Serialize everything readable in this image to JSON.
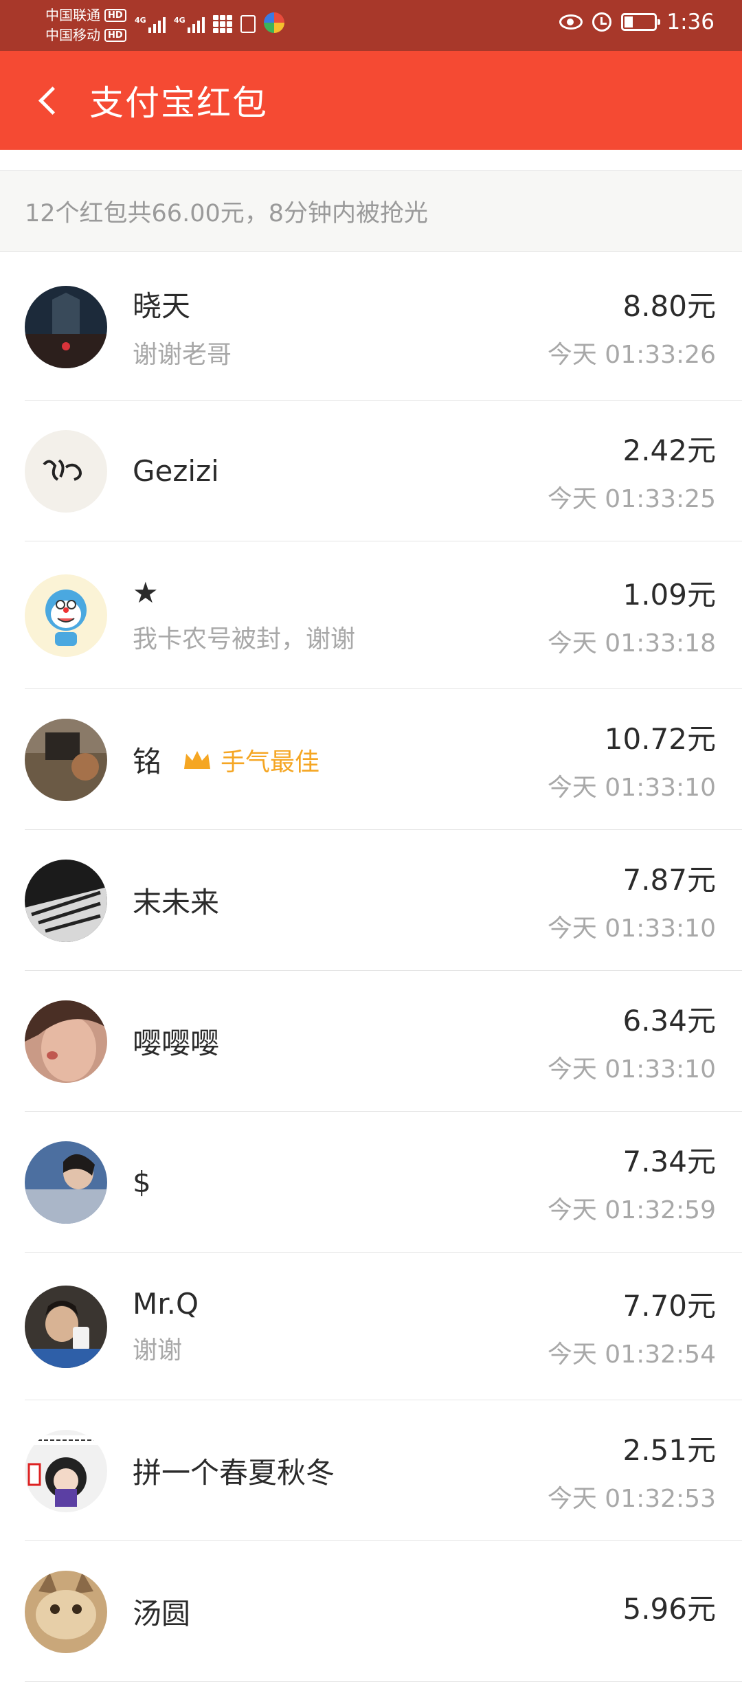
{
  "status_bar": {
    "carrier1": "中国联通",
    "carrier2": "中国移动",
    "hd": "HD",
    "net1": "4G",
    "net2": "4G",
    "time": "1:36"
  },
  "header": {
    "title": "支付宝红包"
  },
  "summary": {
    "text": "12个红包共66.00元，8分钟内被抢光"
  },
  "records": [
    {
      "name": "晓天",
      "note": "谢谢老哥",
      "amount": "8.80元",
      "time": "今天 01:33:26"
    },
    {
      "name": "Gezizi",
      "note": "",
      "amount": "2.42元",
      "time": "今天 01:33:25"
    },
    {
      "name": "★",
      "note": "我卡农号被封，谢谢",
      "amount": "1.09元",
      "time": "今天 01:33:18"
    },
    {
      "name": "铭",
      "note": "",
      "badge": "手气最佳",
      "amount": "10.72元",
      "time": "今天 01:33:10"
    },
    {
      "name": "末未来",
      "note": "",
      "amount": "7.87元",
      "time": "今天 01:33:10"
    },
    {
      "name": "嘤嘤嘤",
      "note": "",
      "amount": "6.34元",
      "time": "今天 01:33:10"
    },
    {
      "name": "$",
      "note": "",
      "amount": "7.34元",
      "time": "今天 01:32:59"
    },
    {
      "name": "Mr.Q",
      "note": "谢谢",
      "amount": "7.70元",
      "time": "今天 01:32:54"
    },
    {
      "name": "拼一个春夏秋冬",
      "note": "",
      "amount": "2.51元",
      "time": "今天 01:32:53"
    },
    {
      "name": "汤圆",
      "note": "",
      "amount": "5.96元",
      "time": ""
    }
  ],
  "avatar_colors": [
    "#1c2a3a",
    "#f3f0ea",
    "#fbf3d6",
    "#6b5a45",
    "#1b1b1b",
    "#c99a86",
    "#4c6fa0",
    "#3a3530",
    "#f1f1f1",
    "#c9a77a"
  ],
  "brand_color": "#f54a33",
  "best_color": "#f5a623"
}
